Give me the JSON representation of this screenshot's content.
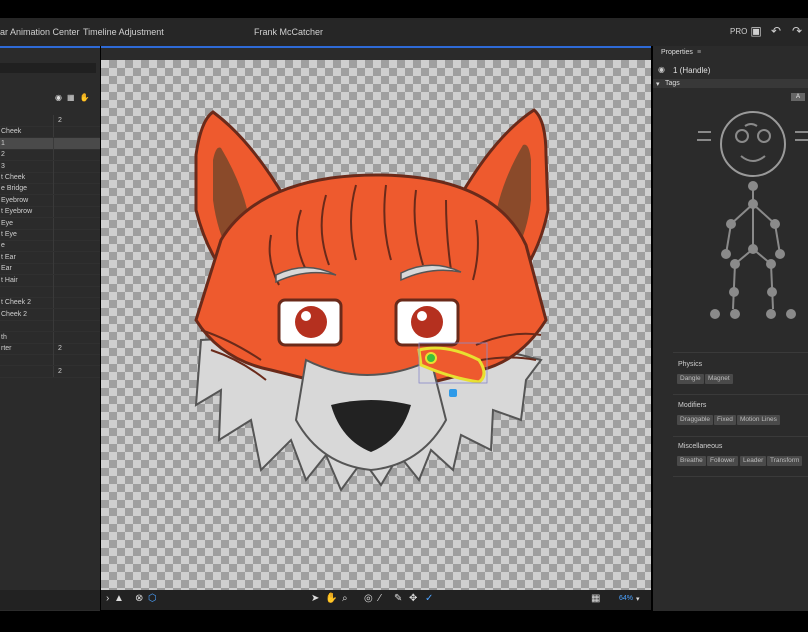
{
  "topbar": {
    "tab_character": "ar Animation Center",
    "tab_timeline": "Timeline Adjustment",
    "project_name": "Frank McCatcher",
    "pro_label": "PRO",
    "icons": [
      "layout-icon",
      "undo-icon",
      "redo-icon"
    ]
  },
  "layers_panel": {
    "column_icons": [
      "visibility-icon",
      "calendar-icon",
      "hand-icon"
    ],
    "rows": [
      {
        "label": "",
        "value": "2"
      },
      {
        "label": "Cheek",
        "value": ""
      },
      {
        "label": "1",
        "value": "",
        "selected": true
      },
      {
        "label": "2",
        "value": ""
      },
      {
        "label": "3",
        "value": ""
      },
      {
        "label": "t Cheek",
        "value": ""
      },
      {
        "label": "e Bridge",
        "value": ""
      },
      {
        "label": "Eyebrow",
        "value": ""
      },
      {
        "label": "t Eyebrow",
        "value": ""
      },
      {
        "label": "Eye",
        "value": ""
      },
      {
        "label": "t Eye",
        "value": ""
      },
      {
        "label": "e",
        "value": ""
      },
      {
        "label": "t Ear",
        "value": ""
      },
      {
        "label": "Ear",
        "value": ""
      },
      {
        "label": "t Hair",
        "value": ""
      },
      {
        "label": "",
        "value": ""
      },
      {
        "label": "t Cheek 2",
        "value": ""
      },
      {
        "label": "Cheek 2",
        "value": ""
      },
      {
        "label": "",
        "value": ""
      },
      {
        "label": "th",
        "value": ""
      },
      {
        "label": "rter",
        "value": "2"
      },
      {
        "label": "",
        "value": ""
      },
      {
        "label": "",
        "value": "2"
      }
    ]
  },
  "canvas_toolbar": {
    "zoom_label": "64%",
    "tools": [
      "select-arrow-icon",
      "hand-tool-icon",
      "zoom-tool-icon",
      "origin-icon",
      "stick-icon",
      "pin-icon",
      "dragger-icon",
      "handle-tool-icon"
    ]
  },
  "properties": {
    "panel_title": "Properties",
    "selection_label": "1 (Handle)",
    "tags_header": "Tags",
    "tags_toggle": "A",
    "sections": [
      {
        "title": "Physics",
        "chips": [
          "Dangle",
          "Magnet"
        ]
      },
      {
        "title": "Modifiers",
        "chips": [
          "Draggable",
          "Fixed",
          "Motion Lines"
        ]
      },
      {
        "title": "Miscellaneous",
        "chips": [
          "Breathe",
          "Follower",
          "Leader",
          "Transform"
        ]
      }
    ]
  },
  "colors": {
    "accent": "#2e6ad6",
    "fox_orange": "#ee5a2e",
    "fox_outline": "#6a2a1a",
    "fur_white": "#d8d8d8",
    "handle_yellow": "#e8e030",
    "handle_green": "#3cc03c",
    "handle_blue": "#2e9ae8"
  }
}
